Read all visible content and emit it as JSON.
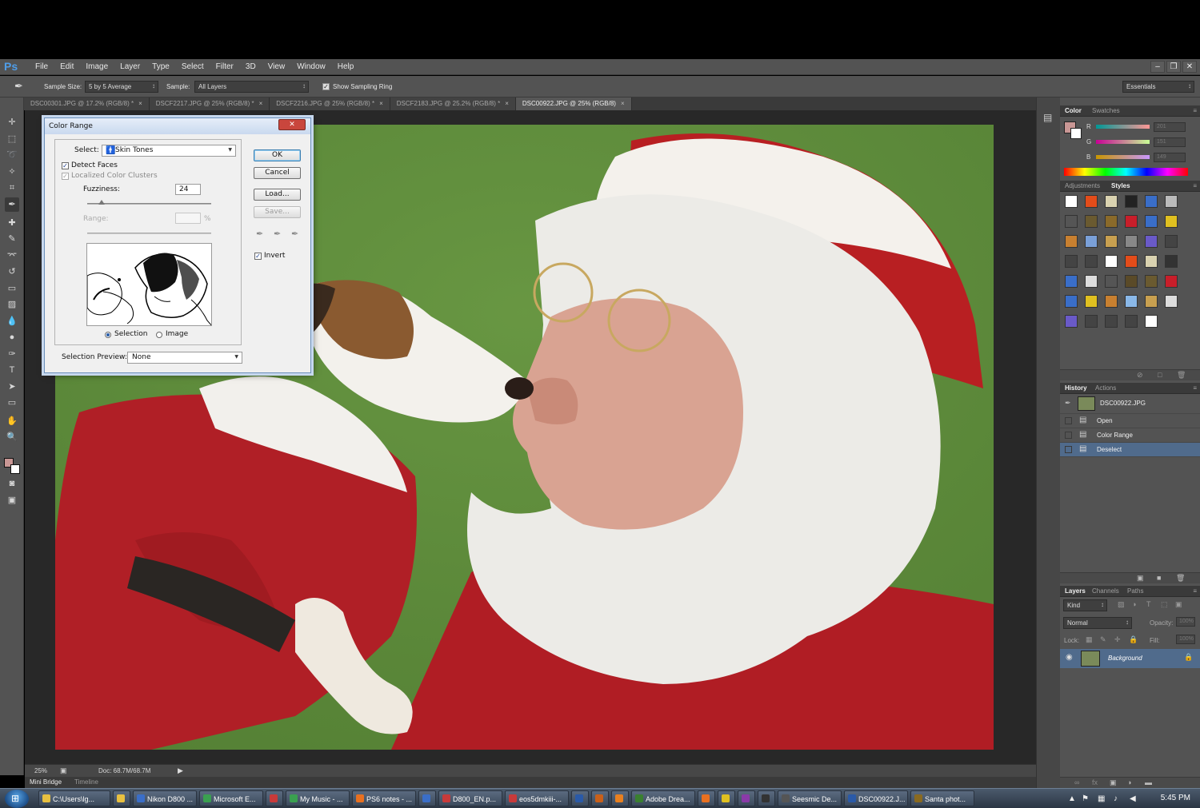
{
  "app": {
    "logo": "Ps"
  },
  "menu": [
    "File",
    "Edit",
    "Image",
    "Layer",
    "Type",
    "Select",
    "Filter",
    "3D",
    "View",
    "Window",
    "Help"
  ],
  "window_controls": [
    "–",
    "❐",
    "✕"
  ],
  "options_bar": {
    "sample_size_label": "Sample Size:",
    "sample_size_value": "5 by 5 Average",
    "sample_label": "Sample:",
    "sample_value": "All Layers",
    "show_sampling_ring_label": "Show Sampling Ring",
    "workspace": "Essentials"
  },
  "tabs": [
    {
      "label": "DSC00301.JPG @ 17.2% (RGB/8) *",
      "active": false
    },
    {
      "label": "DSCF2217.JPG @ 25% (RGB/8) *",
      "active": false
    },
    {
      "label": "DSCF2216.JPG @ 25% (RGB/8) *",
      "active": false
    },
    {
      "label": "DSCF2183.JPG @ 25.2% (RGB/8) *",
      "active": false
    },
    {
      "label": "DSC00922.JPG @ 25% (RGB/8)",
      "active": true
    }
  ],
  "status": {
    "zoom": "25%",
    "doc": "Doc: 68.7M/68.7M"
  },
  "bottom_tabs": {
    "mini_bridge": "Mini Bridge",
    "timeline": "Timeline"
  },
  "color_panel": {
    "tabs": [
      "Color",
      "Swatches"
    ],
    "channels": [
      {
        "label": "R",
        "value": "201"
      },
      {
        "label": "G",
        "value": "151"
      },
      {
        "label": "B",
        "value": "149"
      }
    ],
    "foreground": "#c99795"
  },
  "adjust_panel": {
    "tabs": [
      "Adjustments",
      "Styles"
    ]
  },
  "history_panel": {
    "tabs": [
      "History",
      "Actions"
    ],
    "snapshot": "DSC00922.JPG",
    "steps": [
      "Open",
      "Color Range",
      "Deselect"
    ],
    "selected_step": "Deselect"
  },
  "layers_panel": {
    "tabs": [
      "Layers",
      "Channels",
      "Paths"
    ],
    "kind": "Kind",
    "blend_mode": "Normal",
    "opacity_label": "Opacity:",
    "opacity_value": "100%",
    "lock_label": "Lock:",
    "fill_label": "Fill:",
    "fill_value": "100%",
    "layer_name": "Background"
  },
  "dialog": {
    "title": "Color Range",
    "close": "✕",
    "select_label": "Select:",
    "select_value": "Skin Tones",
    "detect_faces_label": "Detect Faces",
    "detect_faces": true,
    "localized_label": "Localized Color Clusters",
    "localized": true,
    "fuzziness_label": "Fuzziness:",
    "fuzziness_value": "24",
    "range_label": "Range:",
    "range_unit": "%",
    "radio_selection": "Selection",
    "radio_image": "Image",
    "preview_label": "Selection Preview:",
    "preview_value": "None",
    "ok": "OK",
    "cancel": "Cancel",
    "load": "Load...",
    "save": "Save...",
    "invert_label": "Invert",
    "invert": true
  },
  "taskbar": {
    "items": [
      "C:\\Users\\lg...",
      "",
      "Nikon D800 ...",
      "Microsoft E...",
      "",
      "My Music - ...",
      "PS6 notes - ...",
      "",
      "D800_EN.p...",
      "eos5dmkiii-...",
      "",
      "",
      "",
      "Adobe Drea...",
      "",
      "",
      "",
      "",
      "Seesmic De...",
      "DSC00922.J...",
      "Santa phot..."
    ],
    "clock": "5:45 PM"
  }
}
